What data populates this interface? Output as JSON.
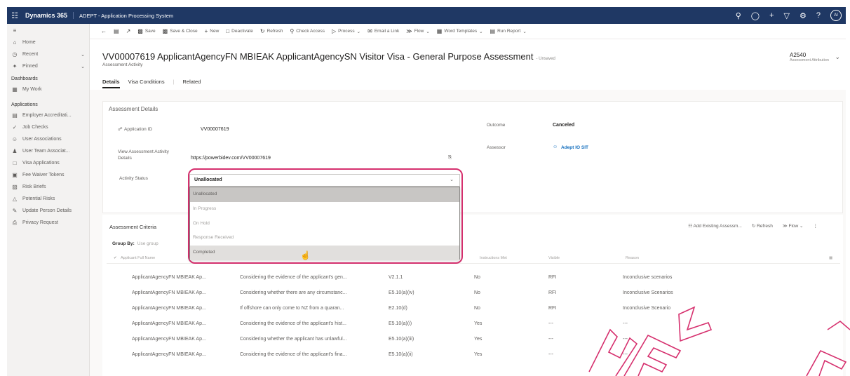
{
  "topbar": {
    "brand": "Dynamics 365",
    "app_name": "ADEPT - Application Processing System",
    "avatar": "AI"
  },
  "sidebar": {
    "top_items": [
      {
        "label": "Home",
        "icon": "home-icon"
      },
      {
        "label": "Recent",
        "icon": "clock-icon"
      },
      {
        "label": "Pinned",
        "icon": "pin-icon"
      }
    ],
    "group_dashboards": "Dashboards",
    "dashboards": [
      {
        "label": "My Work",
        "icon": "grid-icon"
      }
    ],
    "group_applications": "Applications",
    "applications": [
      {
        "label": "Employer Accreditati...",
        "icon": "building-icon"
      },
      {
        "label": "Job Checks",
        "icon": "check-icon"
      },
      {
        "label": "User Associations",
        "icon": "user-link-icon"
      },
      {
        "label": "User Team Associat...",
        "icon": "team-icon"
      },
      {
        "label": "Visa Applications",
        "icon": "document-icon"
      },
      {
        "label": "Fee Waiver Tokens",
        "icon": "token-icon"
      },
      {
        "label": "Risk Briefs",
        "icon": "brief-icon"
      },
      {
        "label": "Potential Risks",
        "icon": "warning-icon"
      },
      {
        "label": "Update Person Details",
        "icon": "person-edit-icon"
      },
      {
        "label": "Privacy Request",
        "icon": "privacy-icon"
      }
    ]
  },
  "commands": [
    {
      "label": "",
      "icon": "back-icon"
    },
    {
      "label": "",
      "icon": "form-icon"
    },
    {
      "label": "",
      "icon": "open-icon"
    },
    {
      "label": "Save",
      "icon": "save-icon"
    },
    {
      "label": "Save & Close",
      "icon": "save-close-icon"
    },
    {
      "label": "New",
      "icon": "plus-icon"
    },
    {
      "label": "Deactivate",
      "icon": "deactivate-icon"
    },
    {
      "label": "Refresh",
      "icon": "refresh-icon"
    },
    {
      "label": "Check Access",
      "icon": "access-icon"
    },
    {
      "label": "Process",
      "icon": "process-icon"
    },
    {
      "label": "Email a Link",
      "icon": "email-icon"
    },
    {
      "label": "Flow",
      "icon": "flow-icon"
    },
    {
      "label": "Word Templates",
      "icon": "word-icon"
    },
    {
      "label": "Run Report",
      "icon": "report-icon"
    }
  ],
  "header": {
    "title": "VV00007619 ApplicantAgencyFN MBIEAK ApplicantAgencySN Visitor Visa - General Purpose Assessment",
    "unsaved": "- Unsaved",
    "subtitle": "Assessment Activity",
    "right_value": "A2540",
    "right_label": "Assessment Attribution"
  },
  "tabs": [
    "Details",
    "Visa Conditions",
    "Related"
  ],
  "assessment_details": {
    "section_title": "Assessment Details",
    "application_id_label": "Application ID",
    "application_id": "VV00007619",
    "view_link_label": "View Assessment Activity Details",
    "view_link": "https://powerbidev.com/VV00007619",
    "status_label": "Activity Status",
    "status_value": "Unallocated",
    "outcome_label": "Outcome",
    "outcome_value": "Canceled",
    "assessor_label": "Assessor",
    "assessor_value": "Adept IO SIT"
  },
  "status_options": [
    "Unallocated",
    "In Progress",
    "On Hold",
    "Response Received",
    "Completed"
  ],
  "criteria": {
    "title": "Assessment Criteria",
    "group_by_label": "Group By:",
    "group_by_value": "Use group",
    "add_button": "Add Existing Assessm...",
    "refresh_button": "Refresh",
    "flow_button": "Flow",
    "columns": [
      "Applicant Full Name",
      "Instructions Met",
      "Visible",
      "Reason"
    ],
    "rows": [
      {
        "name": "ApplicantAgencyFN MBIEAK Ap...",
        "desc": "Considering the evidence of the applicant's gen...",
        "code": "V2.1.1",
        "met": "No",
        "vis": "RFI",
        "reason": "Inconclusive scenarios"
      },
      {
        "name": "ApplicantAgencyFN MBIEAK Ap...",
        "desc": "Considering whether there are any circumstanc...",
        "code": "E5.10(a)(iv)",
        "met": "No",
        "vis": "RFI",
        "reason": "Inconclusive Scenarios"
      },
      {
        "name": "ApplicantAgencyFN MBIEAK Ap...",
        "desc": "If offshore can only come to NZ from a quaran...",
        "code": "E2.10(d)",
        "met": "No",
        "vis": "RFI",
        "reason": "Inconclusive Scenario"
      },
      {
        "name": "ApplicantAgencyFN MBIEAK Ap...",
        "desc": "Considering the evidence of the applicant's hist...",
        "code": "E5.10(a)(i)",
        "met": "Yes",
        "vis": "---",
        "reason": "---"
      },
      {
        "name": "ApplicantAgencyFN MBIEAK Ap...",
        "desc": "Considering whether the applicant has unlawful...",
        "code": "E5.10(a)(iii)",
        "met": "Yes",
        "vis": "---",
        "reason": "---"
      },
      {
        "name": "ApplicantAgencyFN MBIEAK Ap...",
        "desc": "Considering the evidence of the applicant's fina...",
        "code": "E5.10(a)(ii)",
        "met": "Yes",
        "vis": "---",
        "reason": "---"
      }
    ]
  },
  "colors": {
    "topbar": "#1f3864",
    "highlight": "#d6306e",
    "accent": "#0f6cbd"
  }
}
